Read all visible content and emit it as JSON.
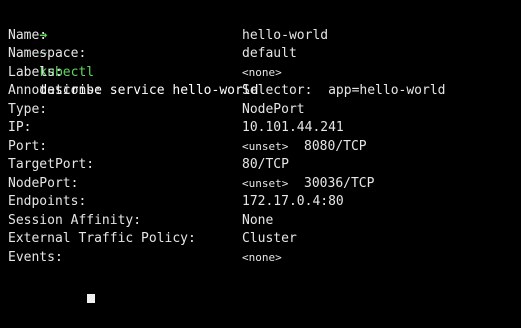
{
  "prompt": {
    "arrow": "→",
    "tilde": "~",
    "command": "kubectl",
    "args": "describe service hello-world"
  },
  "rows": [
    {
      "key": "Name:",
      "value": "hello-world"
    },
    {
      "key": "Namespace:",
      "value": "default"
    },
    {
      "key": "Labels:",
      "value": "<none>"
    },
    {
      "key": "Annotations:",
      "value": "Selector:  app=hello-world"
    },
    {
      "key": "Type:",
      "value": "NodePort"
    },
    {
      "key": "IP:",
      "value": "10.101.44.241"
    },
    {
      "key": "Port:",
      "value_small": "<unset>",
      "value": "8080/TCP"
    },
    {
      "key": "TargetPort:",
      "value": "80/TCP"
    },
    {
      "key": "NodePort:",
      "value_small": "<unset>",
      "value": "30036/TCP"
    },
    {
      "key": "Endpoints:",
      "value": "172.17.0.4:80"
    },
    {
      "key": "Session Affinity:",
      "value": "None"
    },
    {
      "key": "External Traffic Policy:",
      "value": "Cluster"
    },
    {
      "key": "Events:",
      "value": "<none>"
    }
  ],
  "colors": {
    "background": "#000000",
    "text": "#e6e6e6",
    "prompt_arrow": "#5fd75f",
    "prompt_tilde": "#5fc0c0",
    "command": "#5fd75f"
  }
}
